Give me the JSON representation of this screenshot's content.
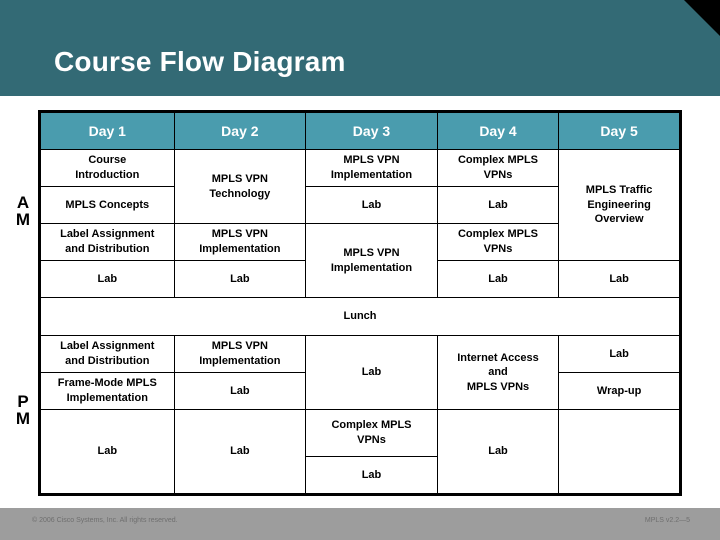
{
  "slide": {
    "title": "Course Flow Diagram",
    "title_band_color": "#336a75",
    "header_cell_color": "#4a9cae",
    "lunch_text_color": "#4a9cae"
  },
  "side_labels": {
    "am": {
      "line1": "A",
      "line2": "M"
    },
    "pm": {
      "line1": "P",
      "line2": "M"
    }
  },
  "table": {
    "columns": [
      "Day 1",
      "Day 2",
      "Day 3",
      "Day 4",
      "Day 5"
    ],
    "am": {
      "row1": {
        "day1": "Course\nIntroduction",
        "day2": "MPLS VPN\nTechnology",
        "day3": "MPLS VPN\nImplementation",
        "day4": "Complex MPLS\nVPNs",
        "day5": "MPLS Traffic\nEngineering\nOverview"
      },
      "row2": {
        "day1": "MPLS Concepts",
        "day3": "Lab",
        "day4": "Lab"
      },
      "row3": {
        "day1": "Label Assignment\nand Distribution",
        "day2": "MPLS VPN\nImplementation",
        "day3": "MPLS VPN\nImplementation",
        "day4": "Complex MPLS\nVPNs"
      },
      "row4": {
        "day1": "Lab",
        "day2": "Lab",
        "day4": "Lab",
        "day5": "Lab"
      }
    },
    "lunch": "Lunch",
    "pm": {
      "row1": {
        "day1": "Label Assignment\nand Distribution",
        "day2": "MPLS VPN\nImplementation",
        "day3": "Lab",
        "day4": "Internet Access\nand\nMPLS VPNs",
        "day5": "Lab"
      },
      "row2": {
        "day1": "Frame-Mode MPLS\nImplementation",
        "day2": "Lab",
        "day5": "Wrap-up"
      },
      "row3": {
        "day1": "Lab",
        "day2": "Lab",
        "day3": "Complex MPLS\nVPNs",
        "day4": "Lab"
      },
      "row4": {
        "day3": "Lab"
      }
    }
  },
  "footer": {
    "copyright": "© 2006 Cisco Systems, Inc. All rights reserved.",
    "doc_code": "MPLS v2.2—5"
  }
}
